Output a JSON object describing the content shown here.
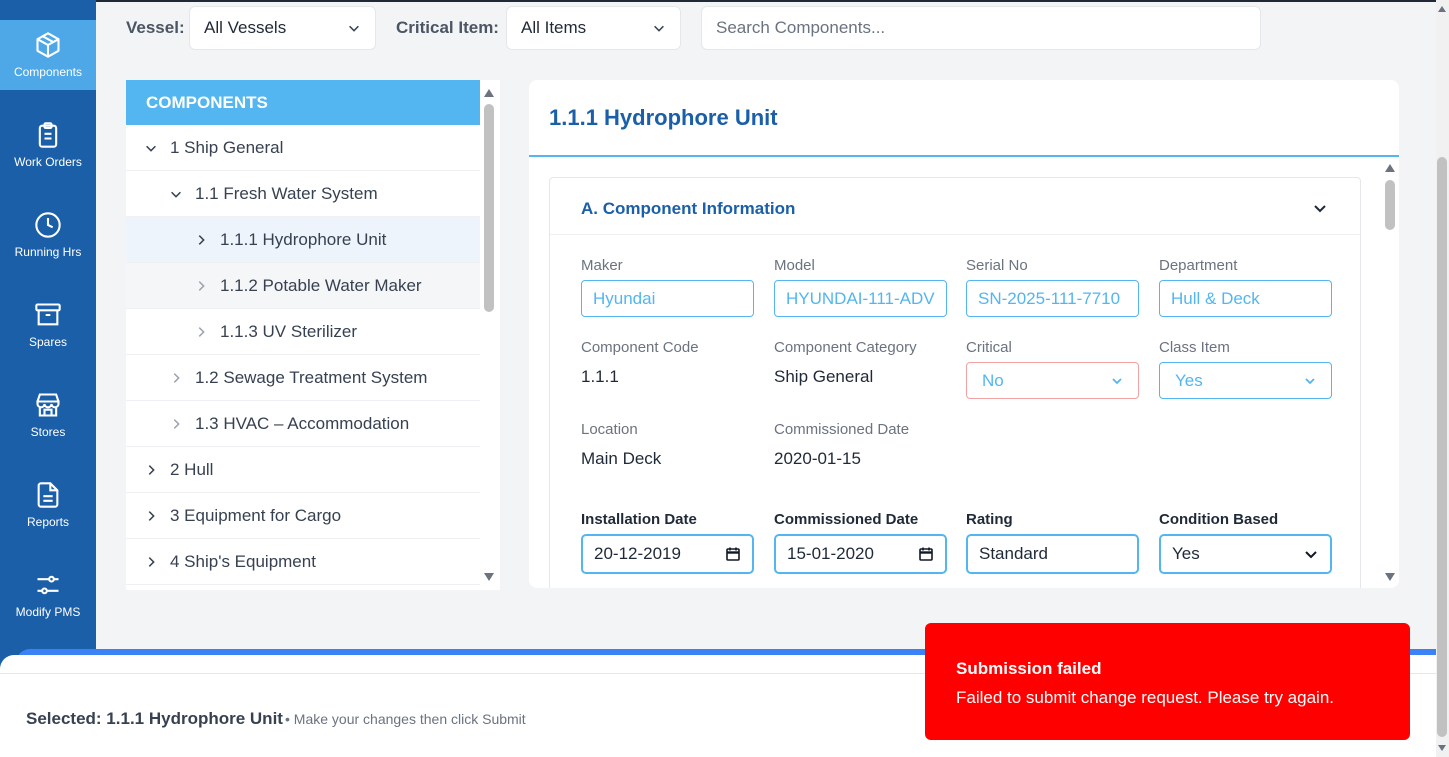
{
  "sidebar": {
    "items": [
      {
        "label": "Components",
        "icon": "box-icon",
        "active": true
      },
      {
        "label": "Work Orders",
        "icon": "clipboard-icon",
        "active": false
      },
      {
        "label": "Running Hrs",
        "icon": "clock-icon",
        "active": false
      },
      {
        "label": "Spares",
        "icon": "archive-icon",
        "active": false
      },
      {
        "label": "Stores",
        "icon": "store-icon",
        "active": false
      },
      {
        "label": "Reports",
        "icon": "file-text-icon",
        "active": false
      },
      {
        "label": "Modify PMS",
        "icon": "sliders-icon",
        "active": false
      }
    ]
  },
  "filters": {
    "vessel_label": "Vessel:",
    "vessel_value": "All Vessels",
    "critical_label": "Critical Item:",
    "critical_value": "All Items",
    "search_placeholder": "Search Components..."
  },
  "tree": {
    "header": "COMPONENTS",
    "rows": [
      {
        "label": "1 Ship General",
        "expanded": true
      },
      {
        "label": "1.1 Fresh Water System",
        "expanded": true
      },
      {
        "label": "1.1.1 Hydrophore Unit",
        "expanded": false,
        "selected": true
      },
      {
        "label": "1.1.2 Potable Water Maker",
        "expanded": false
      },
      {
        "label": "1.1.3 UV Sterilizer",
        "expanded": false
      },
      {
        "label": "1.2 Sewage Treatment System",
        "expanded": false
      },
      {
        "label": "1.3 HVAC – Accommodation",
        "expanded": false
      },
      {
        "label": "2 Hull",
        "expanded": false
      },
      {
        "label": "3 Equipment for Cargo",
        "expanded": false
      },
      {
        "label": "4 Ship's Equipment",
        "expanded": false
      }
    ]
  },
  "detail": {
    "title": "1.1.1 Hydrophore Unit",
    "section_title": "A. Component Information",
    "maker_label": "Maker",
    "maker_value": "Hyundai",
    "model_label": "Model",
    "model_value": "HYUNDAI-111-ADV",
    "serial_label": "Serial No",
    "serial_value": "SN-2025-111-7710",
    "department_label": "Department",
    "department_value": "Hull & Deck",
    "code_label": "Component Code",
    "code_value": "1.1.1",
    "category_label": "Component Category",
    "category_value": "Ship General",
    "critical_label": "Critical",
    "critical_value": "No",
    "class_label": "Class Item",
    "class_value": "Yes",
    "location_label": "Location",
    "location_value": "Main Deck",
    "comm_date_label": "Commissioned Date",
    "comm_date_value": "2020-01-15",
    "install_label": "Installation Date",
    "install_value": "20-12-2019",
    "comm_input_label": "Commissioned Date",
    "comm_input_value": "15-01-2020",
    "rating_label": "Rating",
    "rating_value": "Standard",
    "condition_label": "Condition Based",
    "condition_value": "Yes"
  },
  "bottom": {
    "selected_text": "Selected: 1.1.1 Hydrophore Unit",
    "hint_text": "• Make your changes then click Submit"
  },
  "toast": {
    "title": "Submission failed",
    "message": "Failed to submit change request. Please try again."
  },
  "colors": {
    "sidebar": "#1a5fa8",
    "accent": "#53b6f0",
    "error": "#fe0000"
  }
}
